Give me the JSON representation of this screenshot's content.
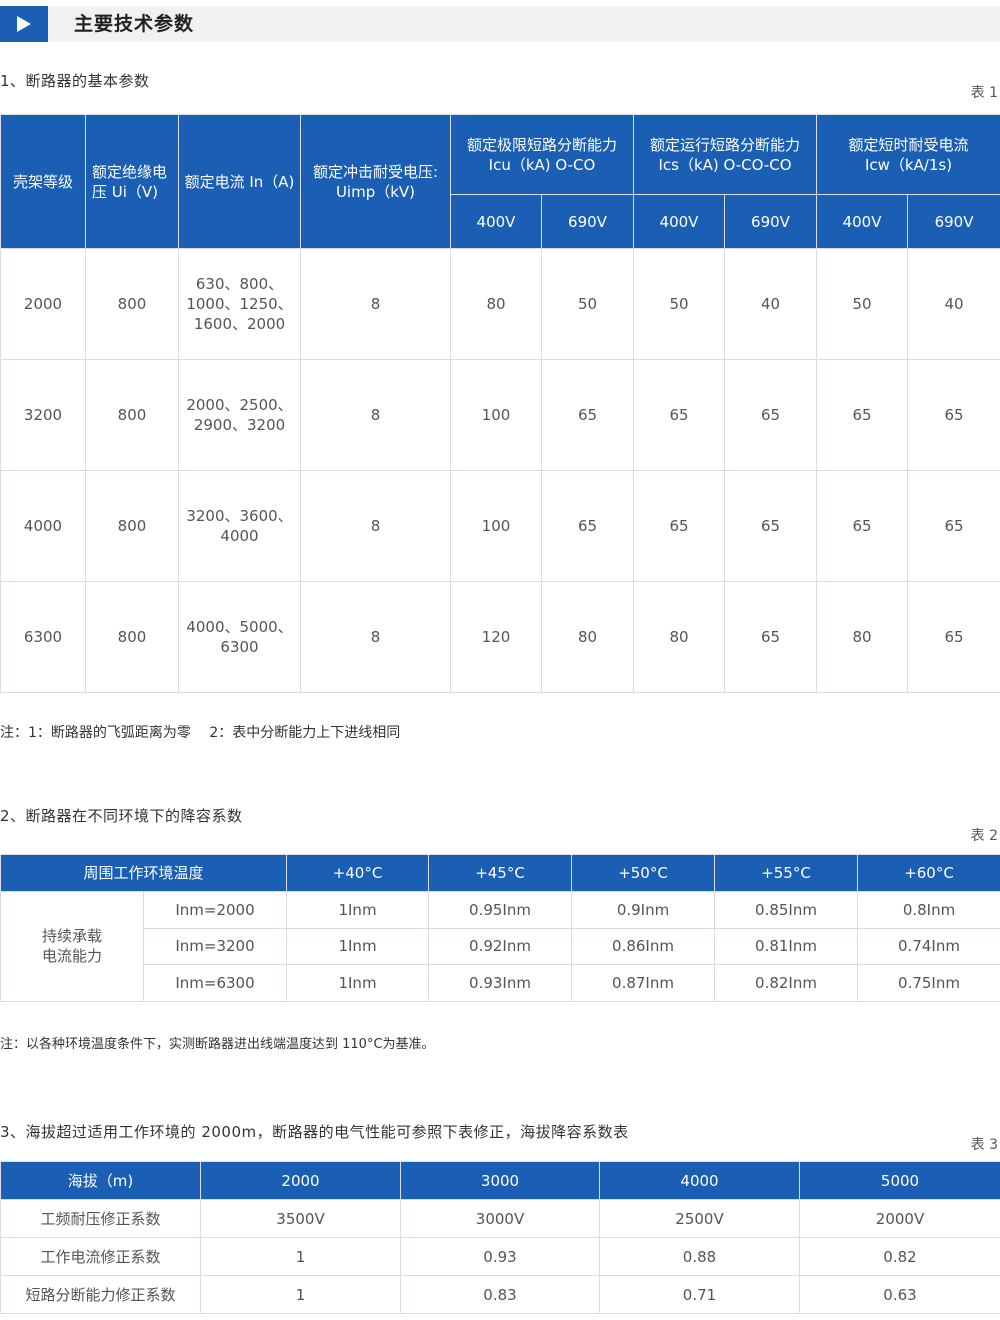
{
  "header": {
    "title": "主要技术参数"
  },
  "section1": {
    "title": "1、断路器的基本参数",
    "table_no": "表 1",
    "headers": {
      "frame": "壳架等级",
      "ui": "额定绝缘电压 Ui（V)",
      "in": "额定电流 In（A)",
      "uimp": "额定冲击耐受电压: Uimp（kV)",
      "icu": "额定极限短路分断能力 Icu（kA) O-CO",
      "ics": "额定运行短路分断能力 Ics（kA) O-CO-CO",
      "icw": "额定短时耐受电流 Icw（kA/1s)",
      "v400": "400V",
      "v690": "690V"
    },
    "rows": [
      [
        "2000",
        "800",
        "630、800、1000、1250、1600、2000",
        "8",
        "80",
        "50",
        "50",
        "40",
        "50",
        "40"
      ],
      [
        "3200",
        "800",
        "2000、2500、2900、3200",
        "8",
        "100",
        "65",
        "65",
        "65",
        "65",
        "65"
      ],
      [
        "4000",
        "800",
        "3200、3600、4000",
        "8",
        "100",
        "65",
        "65",
        "65",
        "65",
        "65"
      ],
      [
        "6300",
        "800",
        "4000、5000、6300",
        "8",
        "120",
        "80",
        "80",
        "65",
        "80",
        "65"
      ]
    ],
    "note": "注：1：断路器的飞弧距离为零　 2：表中分断能力上下进线相同"
  },
  "section2": {
    "title": "2、断路器在不同环境下的降容系数",
    "table_no": "表 2",
    "headers": [
      "周围工作环境温度",
      "+40°C",
      "+45°C",
      "+50°C",
      "+55°C",
      "+60°C"
    ],
    "group_label": "持续承载电流能力",
    "rows": [
      [
        "Inm=2000",
        "1Inm",
        "0.95Inm",
        "0.9Inm",
        "0.85Inm",
        "0.8Inm"
      ],
      [
        "Inm=3200",
        "1Inm",
        "0.92Inm",
        "0.86Inm",
        "0.81Inm",
        "0.74Inm"
      ],
      [
        "Inm=6300",
        "1Inm",
        "0.93Inm",
        "0.87Inm",
        "0.82Inm",
        "0.75Inm"
      ]
    ],
    "note": "注：以各种环境温度条件下，实测断路器进出线端温度达到 110°C为基准。"
  },
  "section3": {
    "title": "3、海拔超过适用工作环境的 2000m，断路器的电气性能可参照下表修正，海拔降容系数表",
    "table_no": "表 3",
    "headers": [
      "海拔（m)",
      "2000",
      "3000",
      "4000",
      "5000"
    ],
    "rows": [
      [
        "工频耐压修正系数",
        "3500V",
        "3000V",
        "2500V",
        "2000V"
      ],
      [
        "工作电流修正系数",
        "1",
        "0.93",
        "0.88",
        "0.82"
      ],
      [
        "短路分断能力修正系数",
        "1",
        "0.83",
        "0.71",
        "0.63"
      ]
    ]
  },
  "colors": {
    "accent": "#1a5fb4",
    "header_bg": "#f1f1f1",
    "border": "#d8dde5"
  },
  "icons": {
    "header_marker": "play-triangle-icon"
  }
}
